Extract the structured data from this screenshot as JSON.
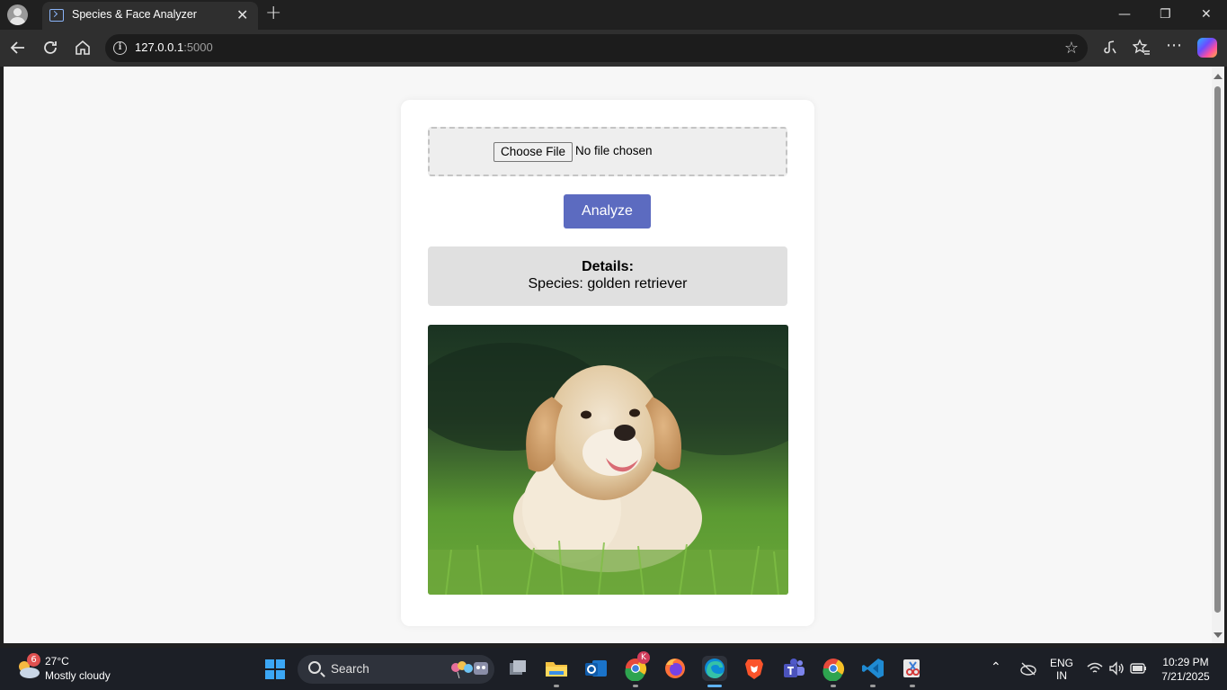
{
  "browser": {
    "tab_title": "Species & Face Analyzer",
    "tab_close": "✕",
    "new_tab": "+",
    "url_host": "127.0.0.1",
    "url_port": ":5000",
    "window_controls": {
      "minimize": "—",
      "restore": "❐",
      "close": "✕"
    }
  },
  "page": {
    "file_input": {
      "button_label": "Choose File",
      "status": "No file chosen"
    },
    "analyze_label": "Analyze",
    "details": {
      "title": "Details:",
      "species": "Species: golden retriever"
    }
  },
  "taskbar": {
    "weather": {
      "temp": "27°C",
      "condition": "Mostly cloudy",
      "badge": "6"
    },
    "search_label": "Search",
    "apps": [
      "task-view",
      "file-explorer",
      "outlook",
      "chrome-profile",
      "firefox",
      "edge",
      "brave",
      "teams",
      "chrome",
      "vscode",
      "snipping-tool"
    ],
    "chrome_profile_badge": "K",
    "language": "ENG",
    "region": "IN",
    "time": "10:29 PM",
    "date": "7/21/2025"
  },
  "colors": {
    "accent": "#5c6bc0",
    "details_bg": "#e0e0e0",
    "page_bg": "#f7f7f7"
  }
}
